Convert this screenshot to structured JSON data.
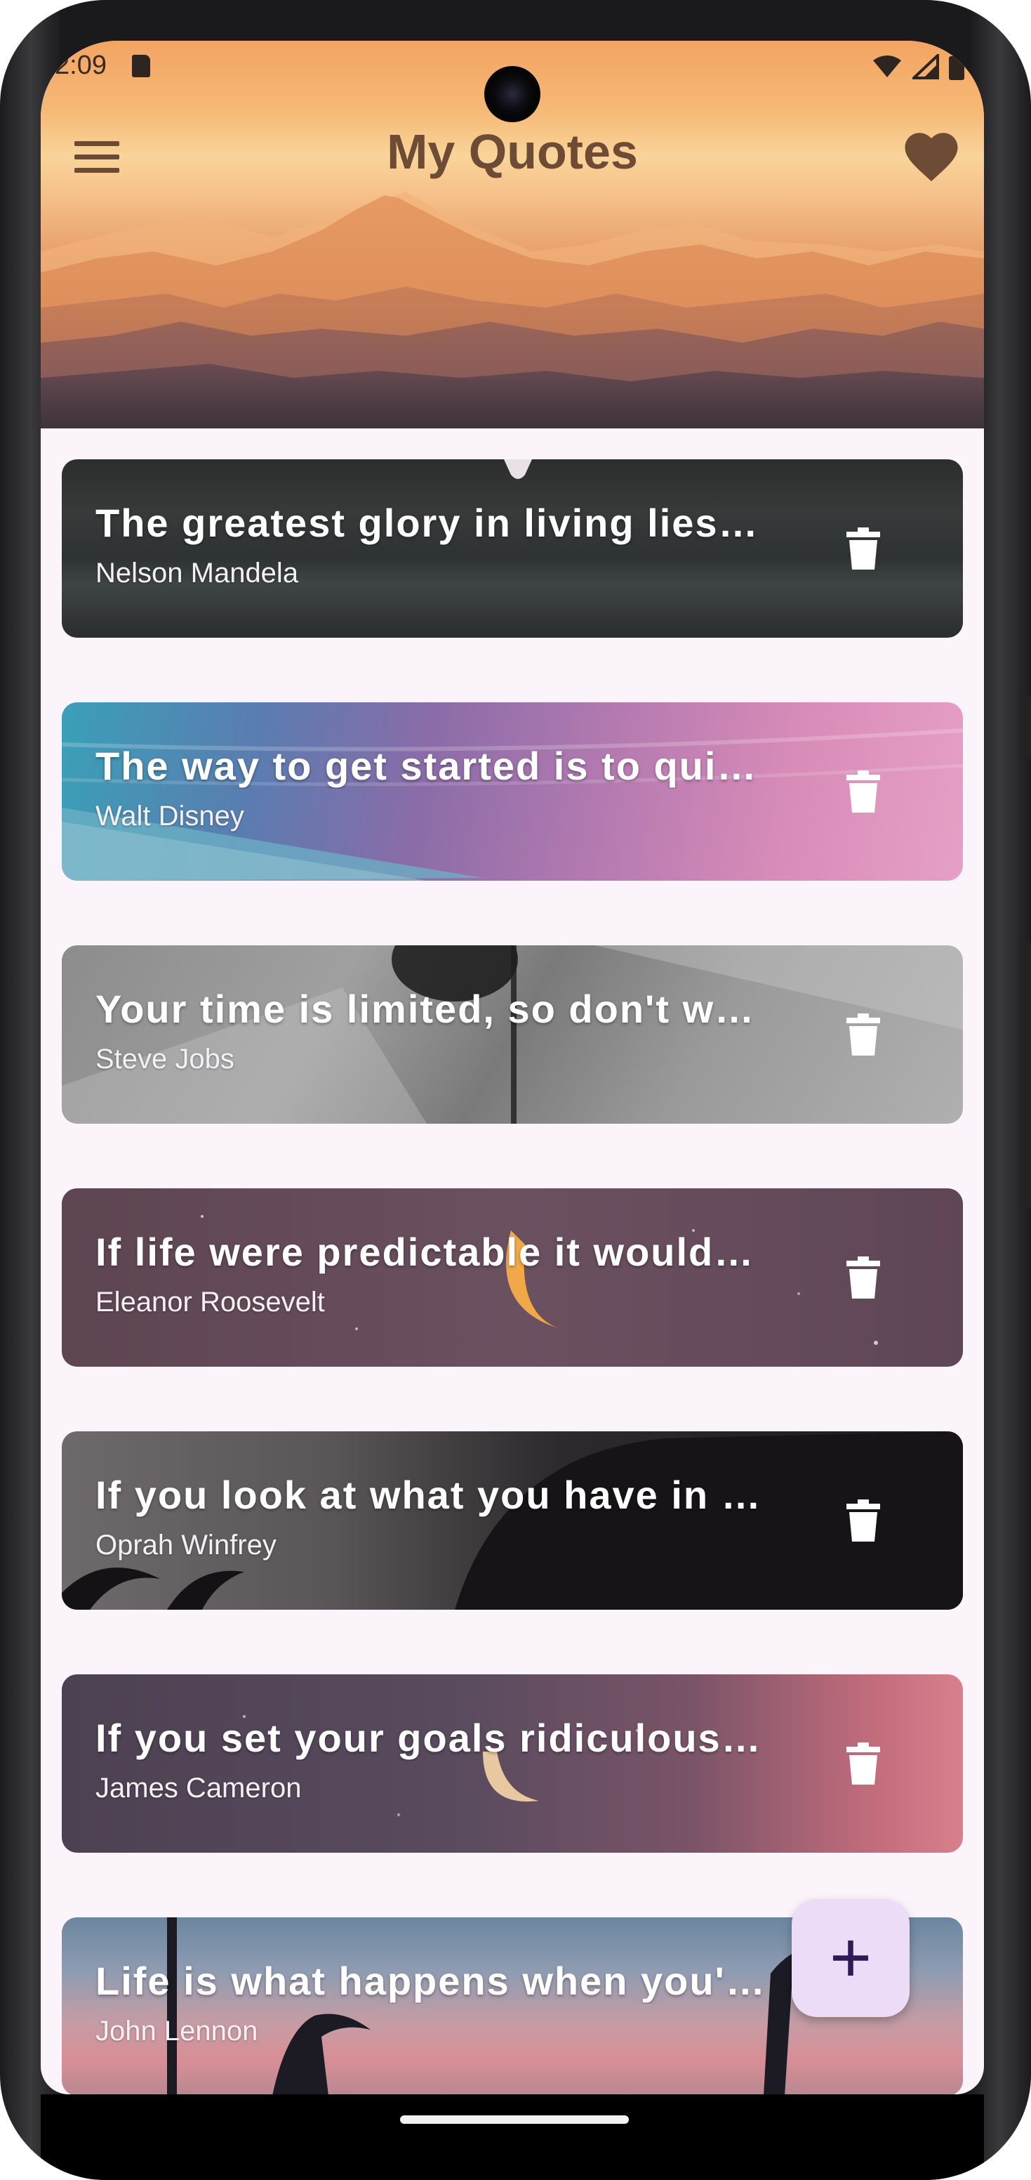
{
  "status_bar": {
    "time": "2:09"
  },
  "header": {
    "title": "My Quotes",
    "menu_icon": "hamburger-menu-icon",
    "favorite_icon": "heart-icon"
  },
  "quotes": [
    {
      "text": "The greatest glory in living lies…",
      "author": "Nelson Mandela"
    },
    {
      "text": "The way to get started is to qui…",
      "author": "Walt Disney"
    },
    {
      "text": "Your time is limited, so don't w…",
      "author": "Steve Jobs"
    },
    {
      "text": "If life were predictable it would…",
      "author": "Eleanor Roosevelt"
    },
    {
      "text": "If you look at what you have in …",
      "author": "Oprah Winfrey"
    },
    {
      "text": "If you set your goals ridiculous…",
      "author": "James Cameron"
    },
    {
      "text": "Life is what happens when you'…",
      "author": "John Lennon"
    }
  ],
  "fab": {
    "icon": "plus-icon"
  },
  "colors": {
    "background": "#fcf4fb",
    "title": "#6e4b34",
    "fab": "#ecdcf8",
    "fab_icon": "#2e1a55"
  }
}
